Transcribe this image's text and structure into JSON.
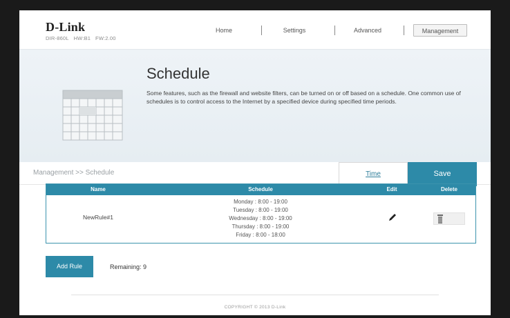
{
  "brand": {
    "logo": "D-Link",
    "model": "DIR-860L",
    "hw": "HW:B1",
    "fw": "FW:2.00"
  },
  "nav": {
    "items": [
      "Home",
      "Settings",
      "Advanced",
      "Management"
    ],
    "active": "Management"
  },
  "hero": {
    "title": "Schedule",
    "description": "Some features, such as the firewall and website filters, can be turned on or off based on a schedule. One common use of schedules is to control access to the Internet by a specified device during specified time periods.",
    "icon": "calendar-icon"
  },
  "breadcrumb": "Management >> Schedule",
  "buttons": {
    "time": "Time",
    "save": "Save",
    "add_rule": "Add Rule"
  },
  "table": {
    "headers": [
      "Name",
      "Schedule",
      "Edit",
      "Delete"
    ],
    "rows": [
      {
        "name": "NewRule#1",
        "schedule": [
          "Monday : 8:00 - 19:00",
          "Tuesday : 8:00 - 19:00",
          "Wednesday : 8:00 - 19:00",
          "Thursday : 8:00 - 19:00",
          "Friday : 8:00 - 18:00"
        ],
        "edit_icon": "pencil-icon",
        "delete_icon": "trash-icon"
      }
    ]
  },
  "remaining": "Remaining: 9",
  "copyright": "COPYRIGHT © 2013 D-Link",
  "colors": {
    "accent": "#2d8aa8",
    "hero_bg": "#e9eff3"
  }
}
